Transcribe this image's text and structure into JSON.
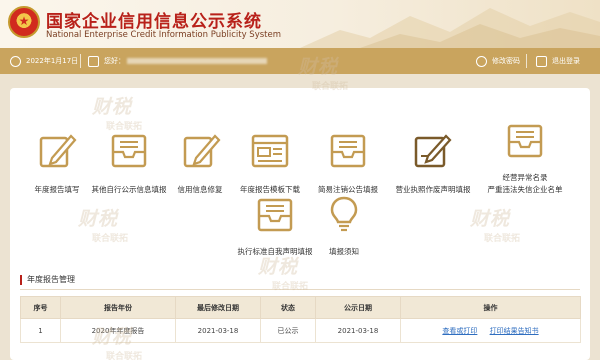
{
  "header": {
    "title_cn": "国家企业信用信息公示系统",
    "title_en": "National Enterprise Credit Information Publicity System"
  },
  "infobar": {
    "date": "2022年1月17日",
    "company_prefix": "您好：",
    "user_label": "修改密码",
    "logout_label": "退出登录"
  },
  "icons": [
    {
      "name": "annual-report-fill-icon",
      "label": "年度报告填写"
    },
    {
      "name": "other-disclosure-icon",
      "label": "其他自行公示信息填报"
    },
    {
      "name": "info-modify-icon",
      "label": "信用信息修复"
    },
    {
      "name": "template-download-icon",
      "label": "年度报告模板下载"
    },
    {
      "name": "simple-cancel-icon",
      "label": "简易注销公告填报"
    },
    {
      "name": "license-void-icon",
      "label": "营业执照作废声明填报"
    },
    {
      "name": "abnormal-list-icon",
      "label_line1": "经营异常名录",
      "label_line2": "严重违法失信企业名单"
    },
    {
      "name": "standard-declaration-icon",
      "label": "执行标准自我声明填报"
    },
    {
      "name": "notice-icon",
      "label": "填报须知"
    }
  ],
  "section": {
    "title": "年度报告管理"
  },
  "table": {
    "headers": [
      "序号",
      "报告年份",
      "最后修改日期",
      "状态",
      "公示日期",
      "操作"
    ],
    "rows": [
      {
        "index": "1",
        "year": "2020年年度报告",
        "modified": "2021-03-18",
        "status": "已公示",
        "published": "2021-03-18",
        "action1": "查看或打印",
        "action2": "打印结果告知书"
      }
    ]
  },
  "watermark": {
    "big": "财税",
    "small": "联合联拓"
  },
  "colors": {
    "brand_red": "#b8211a",
    "gold_bar": "#c9a45e",
    "icon_brown": "#c39b52",
    "link_blue": "#2f6ec0",
    "page_bg": "#ece3d2"
  }
}
